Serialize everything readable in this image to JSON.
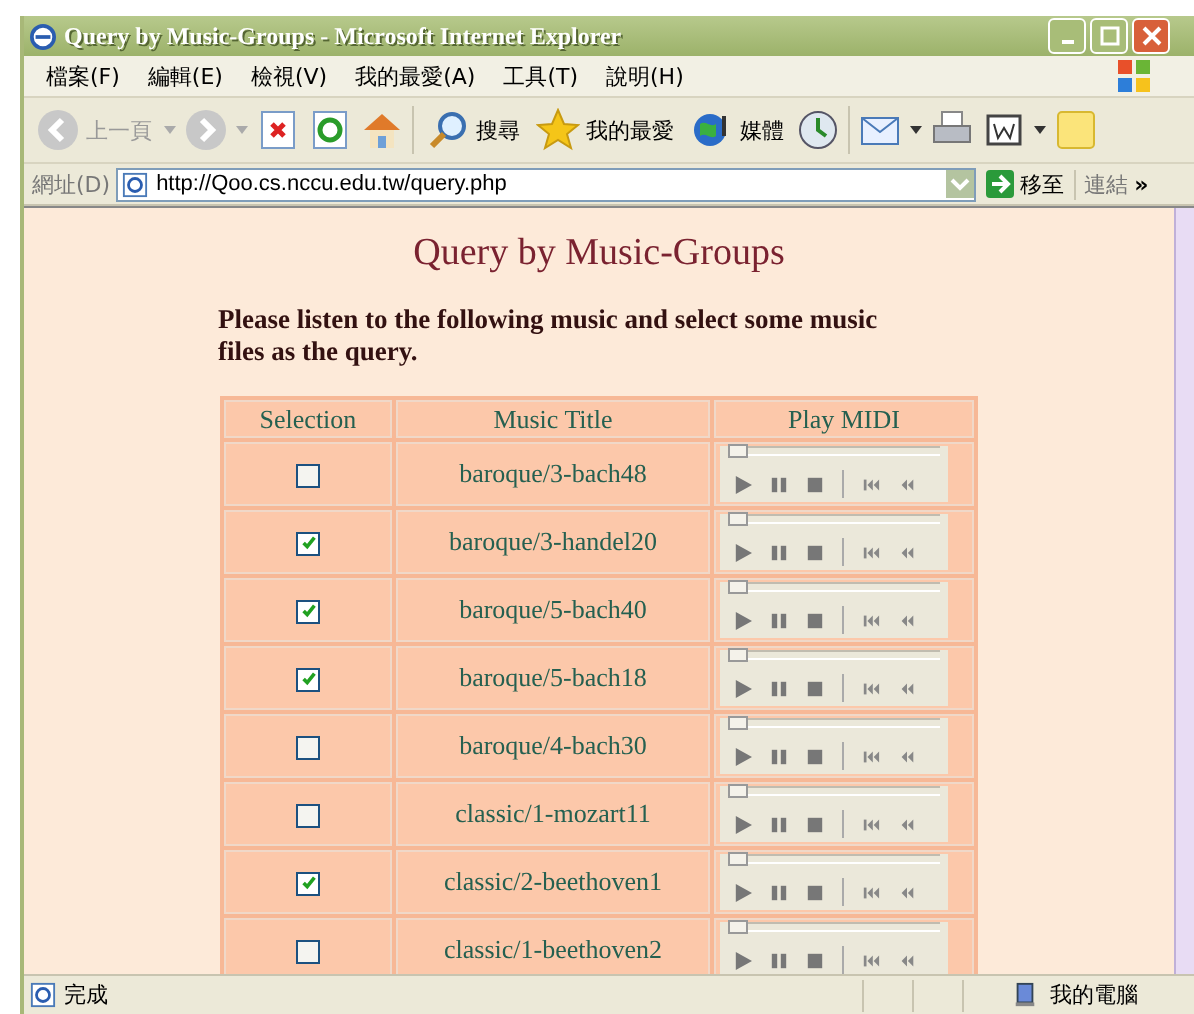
{
  "window": {
    "title": "Query by Music-Groups - Microsoft Internet Explorer"
  },
  "menu": [
    "檔案(F)",
    "編輯(E)",
    "檢視(V)",
    "我的最愛(A)",
    "工具(T)",
    "說明(H)"
  ],
  "toolbar": {
    "back": "上一頁",
    "search": "搜尋",
    "favorites": "我的最愛",
    "media": "媒體"
  },
  "address": {
    "label": "網址(D)",
    "url": "http://Qoo.cs.nccu.edu.tw/query.php",
    "go": "移至",
    "links": "連結",
    "more": "»"
  },
  "page": {
    "heading": "Query by Music-Groups",
    "intro": "Please listen to the following music and select some music files as the query.",
    "columns": [
      "Selection",
      "Music Title",
      "Play MIDI"
    ],
    "rows": [
      {
        "checked": false,
        "title": "baroque/3-bach48",
        "level": 0
      },
      {
        "checked": true,
        "title": "baroque/3-handel20",
        "level": 0
      },
      {
        "checked": true,
        "title": "baroque/5-bach40",
        "level": 0
      },
      {
        "checked": true,
        "title": "baroque/5-bach18",
        "level": 0
      },
      {
        "checked": false,
        "title": "baroque/4-bach30",
        "level": 0
      },
      {
        "checked": false,
        "title": "classic/1-mozart11",
        "level": 0
      },
      {
        "checked": true,
        "title": "classic/2-beethoven1",
        "level": 0
      },
      {
        "checked": false,
        "title": "classic/1-beethoven2",
        "level": 0
      }
    ]
  },
  "status_bar": {
    "text": "完成",
    "zone": "我的電腦"
  }
}
